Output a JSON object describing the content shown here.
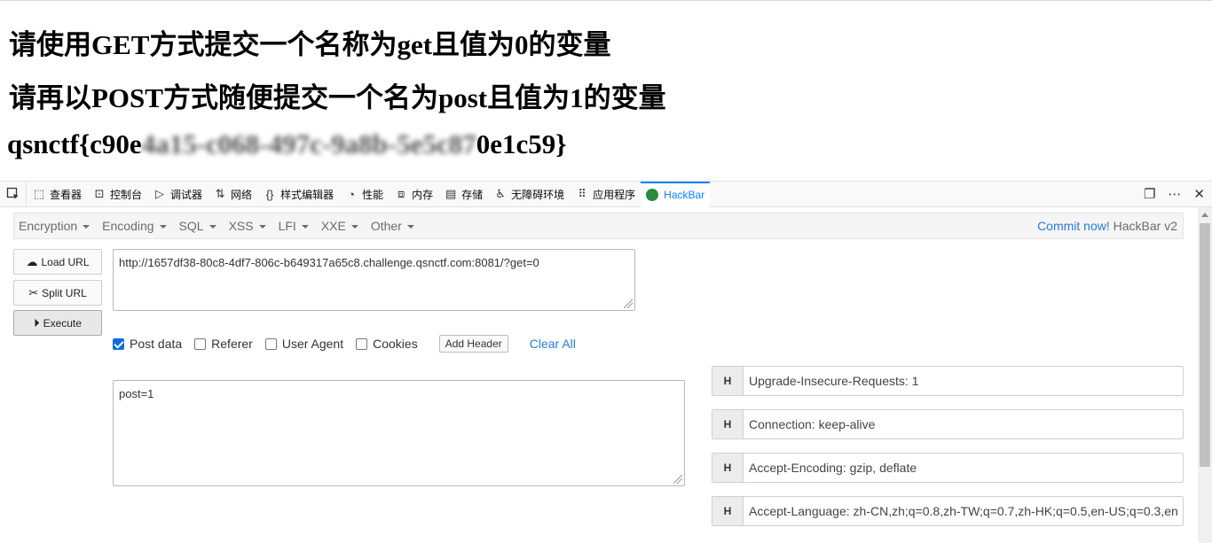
{
  "page": {
    "line1": "请使用GET方式提交一个名称为get且值为0的变量",
    "line2": "请再以POST方式随便提交一个名为post且值为1的变量",
    "flag_prefix": "qsnctf{c90e",
    "flag_blurred": "4a15-c068-497c-9a8b-5e5c87",
    "flag_suffix": "0e1c59}"
  },
  "devtools": {
    "tabs": [
      {
        "label": "查看器",
        "icon": "inspector-icon",
        "glyph": "⬚"
      },
      {
        "label": "控制台",
        "icon": "console-icon",
        "glyph": "⊡"
      },
      {
        "label": "调试器",
        "icon": "debugger-icon",
        "glyph": "▷"
      },
      {
        "label": "网络",
        "icon": "network-icon",
        "glyph": "⇅"
      },
      {
        "label": "样式编辑器",
        "icon": "style-editor-icon",
        "glyph": "{}"
      },
      {
        "label": "性能",
        "icon": "performance-icon",
        "glyph": "◔"
      },
      {
        "label": "内存",
        "icon": "memory-icon",
        "glyph": "⧈"
      },
      {
        "label": "存储",
        "icon": "storage-icon",
        "glyph": "▤"
      },
      {
        "label": "无障碍环境",
        "icon": "accessibility-icon",
        "glyph": "♿"
      },
      {
        "label": "应用程序",
        "icon": "application-icon",
        "glyph": "⠿"
      },
      {
        "label": "HackBar",
        "icon": "hackbar-icon",
        "glyph": ""
      }
    ]
  },
  "hackbar": {
    "menus": [
      "Encryption",
      "Encoding",
      "SQL",
      "XSS",
      "LFI",
      "XXE",
      "Other"
    ],
    "commit_label": "Commit now!",
    "version_label": "HackBar v2",
    "load_url_label": "Load URL",
    "split_url_label": "Split URL",
    "execute_label": "Execute",
    "url_value": "http://1657df38-80c8-4df7-806c-b649317a65c8.challenge.qsnctf.com:8081/?get=0",
    "options": [
      {
        "label": "Post data",
        "checked": true
      },
      {
        "label": "Referer",
        "checked": false
      },
      {
        "label": "User Agent",
        "checked": false
      },
      {
        "label": "Cookies",
        "checked": false
      }
    ],
    "add_header_label": "Add Header",
    "clear_all_label": "Clear All",
    "post_value": "post=1",
    "header_tag": "H",
    "headers": [
      "Upgrade-Insecure-Requests: 1",
      "Connection: keep-alive",
      "Accept-Encoding: gzip, deflate",
      "Accept-Language: zh-CN,zh;q=0.8,zh-TW;q=0.7,zh-HK;q=0.5,en-US;q=0.3,en"
    ]
  }
}
